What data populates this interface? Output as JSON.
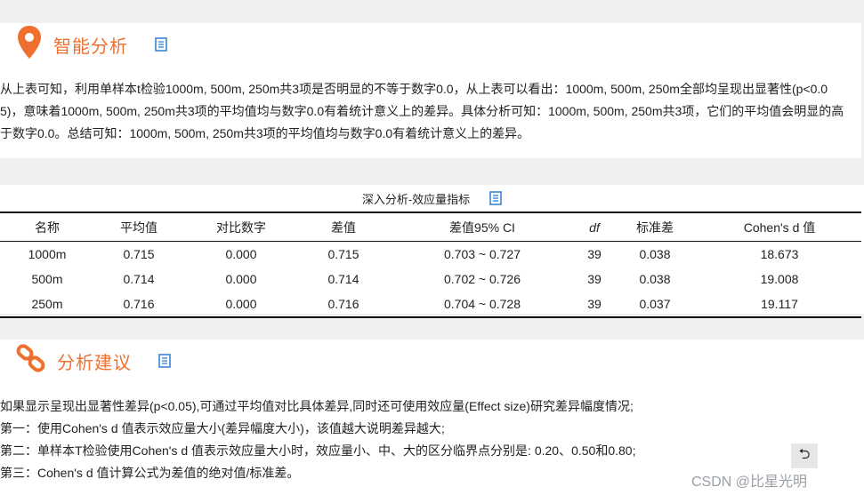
{
  "smart_analysis": {
    "title": "智能分析",
    "icon": "location-pin-icon",
    "accent_color": "#ef6f2e",
    "text_line1": "从上表可知，利用单样本t检验1000m, 500m, 250m共3项是否明显的不等于数字0.0，从上表可以看出：1000m, 500m, 250m全部均呈现出显著性(p<0.0",
    "text_line2": "5)，意味着1000m, 500m, 250m共3项的平均值均与数字0.0有着统计意义上的差异。具体分析可知：1000m, 500m, 250m共3项，它们的平均值会明显的高",
    "text_line3": "于数字0.0。总结可知：1000m, 500m, 250m共3项的平均值均与数字0.0有着统计意义上的差异。"
  },
  "effect_table": {
    "caption": "深入分析-效应量指标",
    "headers": [
      "名称",
      "平均值",
      "对比数字",
      "差值",
      "差值95% CI",
      "df",
      "标准差",
      "Cohen's d 值"
    ],
    "rows": [
      [
        "1000m",
        "0.715",
        "0.000",
        "0.715",
        "0.703 ~ 0.727",
        "39",
        "0.038",
        "18.673"
      ],
      [
        "500m",
        "0.714",
        "0.000",
        "0.714",
        "0.702 ~ 0.726",
        "39",
        "0.038",
        "19.008"
      ],
      [
        "250m",
        "0.716",
        "0.000",
        "0.716",
        "0.704 ~ 0.728",
        "39",
        "0.037",
        "19.117"
      ]
    ]
  },
  "advice": {
    "title": "分析建议",
    "icon": "link-chain-icon",
    "lines": [
      "如果显示呈现出显著性差异(p<0.05),可通过平均值对比具体差异,同时还可使用效应量(Effect size)研究差异幅度情况;",
      "第一：使用Cohen's d 值表示效应量大小(差异幅度大小)，该值越大说明差异越大;",
      "第二：单样本T检验使用Cohen's d 值表示效应量大小时，效应量小、中、大的区分临界点分别是: 0.20、0.50和0.80;",
      "第三：Cohen's d 值计算公式为差值的绝对值/标准差。"
    ]
  },
  "back_button": {
    "symbol": "⮌",
    "icon": "return-arrow-icon"
  },
  "watermark": "CSDN @比星光明",
  "doc_icon_color": "#2f7fd1"
}
